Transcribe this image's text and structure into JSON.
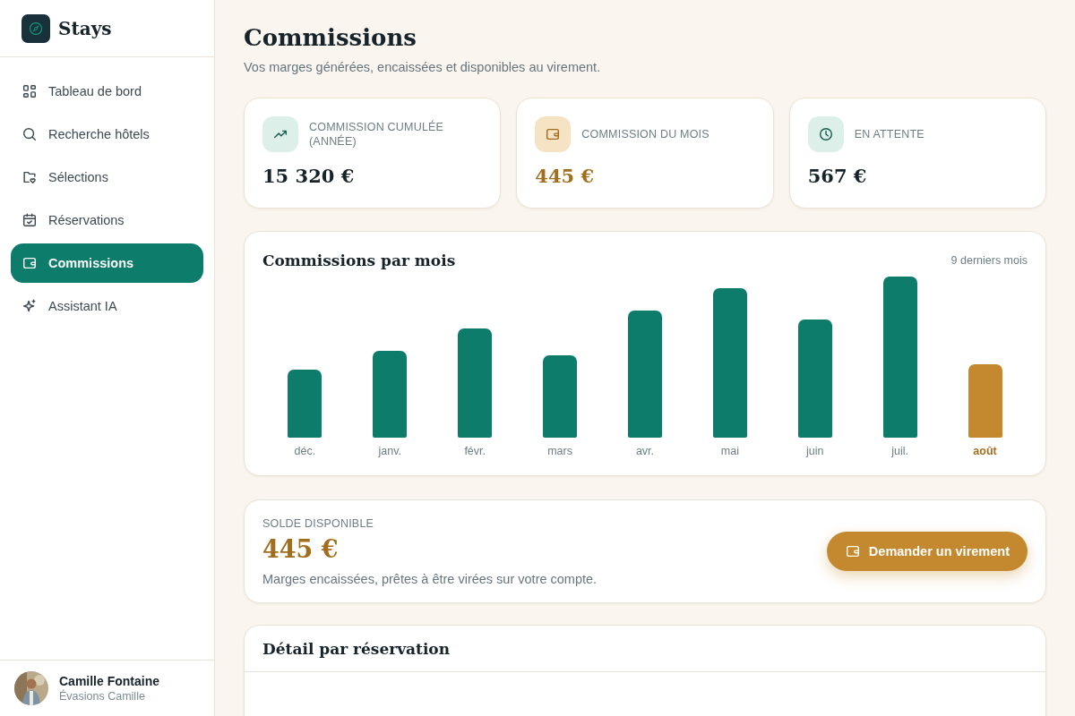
{
  "brand": {
    "name": "Stays"
  },
  "nav": [
    {
      "label": "Tableau de bord",
      "selected": false
    },
    {
      "label": "Recherche hôtels",
      "selected": false
    },
    {
      "label": "Sélections",
      "selected": false
    },
    {
      "label": "Réservations",
      "selected": false
    },
    {
      "label": "Commissions",
      "selected": true
    },
    {
      "label": "Assistant IA",
      "selected": false
    }
  ],
  "user": {
    "name": "Camille Fontaine",
    "agency": "Évasions Camille"
  },
  "page": {
    "title": "Commissions",
    "subtitle": "Vos marges générées, encaissées et disponibles au virement."
  },
  "stats": [
    {
      "label": "COMMISSION CUMULÉE (ANNÉE)",
      "value": "15 320 €",
      "highlighted": false
    },
    {
      "label": "COMMISSION DU MOIS",
      "value": "445 €",
      "highlighted": true
    },
    {
      "label": "EN ATTENTE",
      "value": "567 €",
      "highlighted": false
    }
  ],
  "monthly": {
    "title": "Commissions par mois",
    "period": "9 derniers mois",
    "months": [
      {
        "label": "déc.",
        "highlighted": false
      },
      {
        "label": "janv.",
        "highlighted": false
      },
      {
        "label": "févr.",
        "highlighted": false
      },
      {
        "label": "mars",
        "highlighted": false
      },
      {
        "label": "avr.",
        "highlighted": false
      },
      {
        "label": "mai",
        "highlighted": false
      },
      {
        "label": "juin",
        "highlighted": false
      },
      {
        "label": "juil.",
        "highlighted": false
      },
      {
        "label": "août",
        "highlighted": true
      }
    ]
  },
  "balance": {
    "label": "SOLDE DISPONIBLE",
    "value": "445 €",
    "note": "Marges encaissées, prêtes à être virées sur votre compte.",
    "button": "Demander un virement"
  },
  "detail": {
    "title": "Détail par réservation"
  }
}
